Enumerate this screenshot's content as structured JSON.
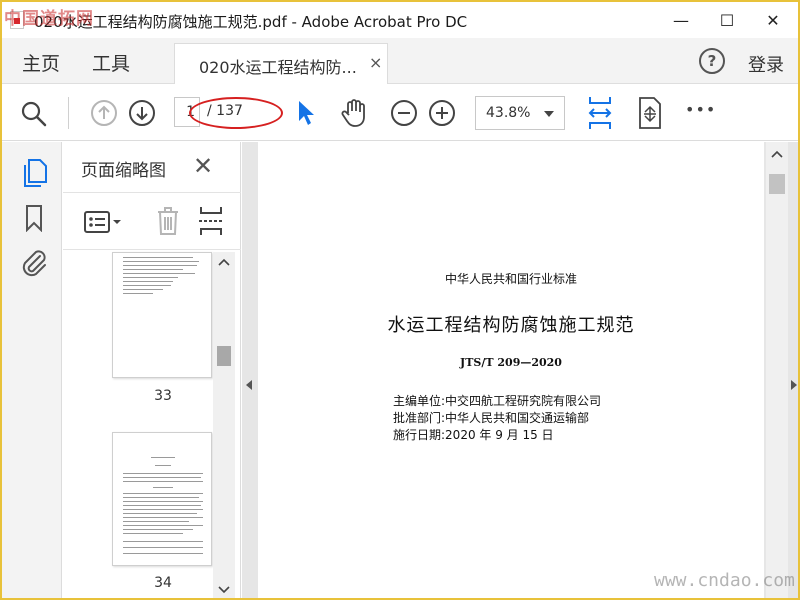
{
  "window": {
    "title": "020水运工程结构防腐蚀施工规范.pdf - Adobe Acrobat Pro DC",
    "watermark_top": "中国道拓网",
    "watermark_bottom": "www.cndao.com",
    "minimize": "—",
    "maximize": "☐",
    "close": "✕"
  },
  "menubar": {
    "home": "主页",
    "tools": "工具",
    "tab_label": "020水运工程结构防...",
    "tab_close": "×",
    "help": "?",
    "login": "登录"
  },
  "toolbar": {
    "current_page": "1",
    "total_pages": "/ 137",
    "zoom": "43.8%",
    "more": "•••"
  },
  "thumbnail_panel": {
    "title": "页面缩略图",
    "close": "✕",
    "thumbs": [
      {
        "page_number": "33"
      },
      {
        "page_number": "34"
      }
    ]
  },
  "document": {
    "category": "中华人民共和国行业标准",
    "title": "水运工程结构防腐蚀施工规范",
    "code": "JTS/T 209—2020",
    "editor": "主编单位:中交四航工程研究院有限公司",
    "approver": "批准部门:中华人民共和国交通运输部",
    "effective_date": "施行日期:2020 年 9 月 15 日"
  },
  "colors": {
    "accent_blue": "#1473e6",
    "highlight_red": "#d62020",
    "frame_yellow": "#e8c23a"
  }
}
